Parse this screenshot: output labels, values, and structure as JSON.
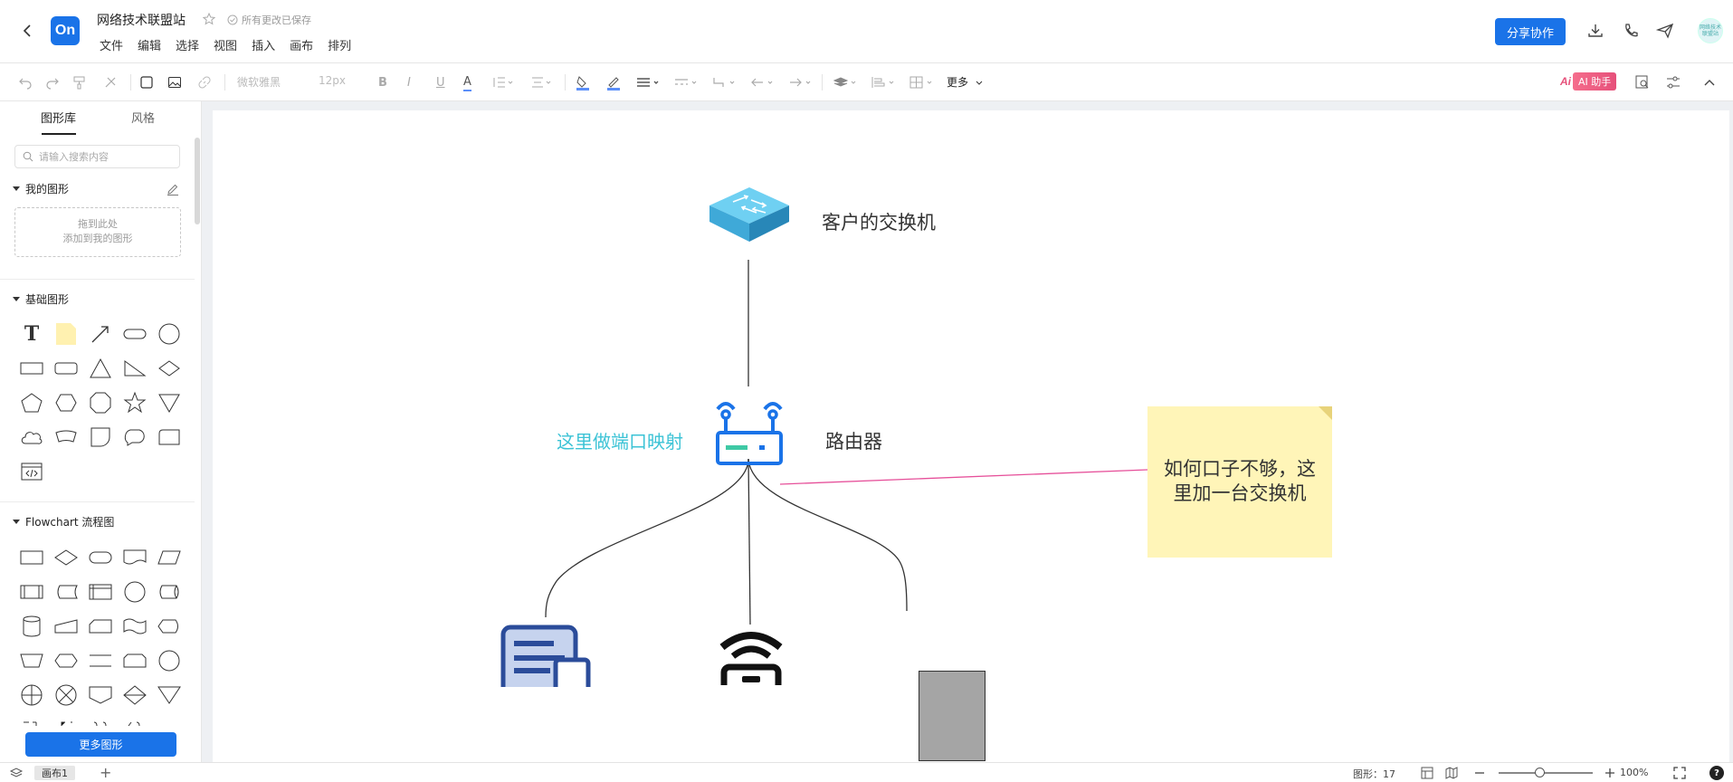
{
  "header": {
    "logo_text": "On",
    "doc_title": "网络技术联盟站",
    "save_status": "所有更改已保存",
    "menu": [
      "文件",
      "编辑",
      "选择",
      "视图",
      "插入",
      "画布",
      "排列"
    ],
    "share_label": "分享协作",
    "avatar_text": "网络技术联盟站"
  },
  "toolbar": {
    "font_name": "微软雅黑",
    "font_size": "12px",
    "more_label": "更多",
    "ai_logo": "Ai",
    "ai_label": "AI 助手"
  },
  "sidebar": {
    "tabs": [
      "图形库",
      "风格"
    ],
    "search_placeholder": "请输入搜索内容",
    "my_shapes": {
      "title": "我的图形",
      "drop_line1": "拖到此处",
      "drop_line2": "添加到我的图形"
    },
    "basic_title": "基础图形",
    "flowchart_title": "Flowchart 流程图",
    "more_shapes_label": "更多图形"
  },
  "canvas": {
    "switch_label": "客户的交换机",
    "router_label": "路由器",
    "port_mapping_label": "这里做端口映射",
    "note_text": "如何口子不够，这里加一台交换机",
    "colors": {
      "port_label": "#3cc3d6",
      "note_bg": "#fff5b8",
      "pink_edge": "#e6509a",
      "router": "#1a73e8",
      "switch": "#5bc4ea",
      "server_gray": "#a5a5a5"
    }
  },
  "bottombar": {
    "page_tab": "画布1",
    "shape_count": "图形：17",
    "zoom_level": "100%"
  }
}
